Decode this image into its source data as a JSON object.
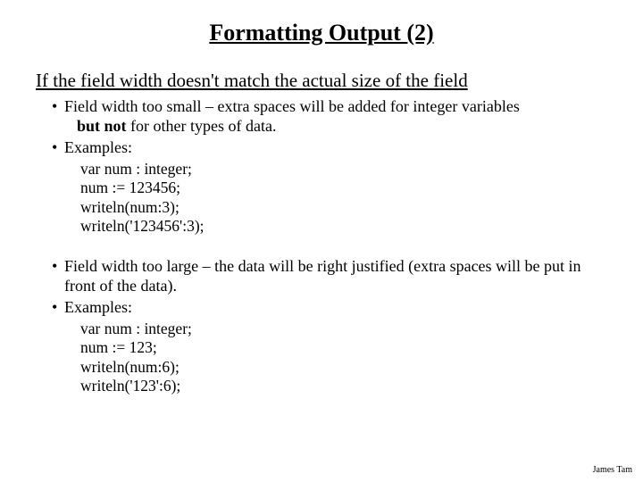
{
  "title": "Formatting Output (2)",
  "lead": "If the field width doesn't match the actual size of the field",
  "sect1": {
    "bullet1_a": "Field width too small – extra spaces will be added for integer variables",
    "bullet1_b_prefix": "but not",
    "bullet1_b_rest": " for other types of data.",
    "bullet2": "Examples:",
    "code": {
      "l1": "var num : integer;",
      "l2": "num := 123456;",
      "l3": "writeln(num:3);",
      "l4": "writeln('123456':3);"
    }
  },
  "sect2": {
    "bullet1": "Field width too large – the data will be right justified (extra spaces will be put in front of the data).",
    "bullet2": "Examples:",
    "code": {
      "l1": "var num : integer;",
      "l2": "num := 123;",
      "l3": "writeln(num:6);",
      "l4": "writeln('123':6);"
    }
  },
  "footer": "James Tam"
}
